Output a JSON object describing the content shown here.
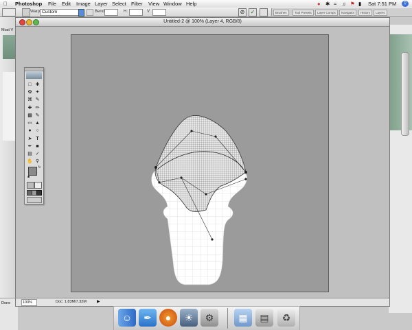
{
  "menubar": {
    "app_name": "Photoshop",
    "items": [
      "File",
      "Edit",
      "Image",
      "Layer",
      "Select",
      "Filter",
      "View",
      "Window",
      "Help"
    ],
    "clock": "Sat 7:51 PM"
  },
  "optionsbar": {
    "warp_label": "Warp:",
    "warp_value": "Custom",
    "bend_label": "Bend:",
    "h_label": "H:",
    "v_label": "V:",
    "palette_tabs": [
      "Brushes",
      "Tool Presets",
      "Layer Comps",
      "Navigator",
      "History",
      "Layers"
    ]
  },
  "document": {
    "title": "Untitled-2 @ 100% (Layer 4, RGB/8)",
    "zoom": "100%",
    "doc_size": "Doc: 1.83M/7.32M"
  },
  "left_window": {
    "text": "Most V",
    "bottom_text": "Done"
  },
  "dock": {
    "icons": [
      "finder-icon",
      "feather-app-icon",
      "firefox-icon",
      "photo-app-icon",
      "app-icon",
      "folder-icon",
      "document-icon",
      "trash-icon"
    ]
  },
  "colors": {
    "canvas_bg": "#9b9b9b",
    "artboard": "#ffffff",
    "mesh": "#333333"
  }
}
